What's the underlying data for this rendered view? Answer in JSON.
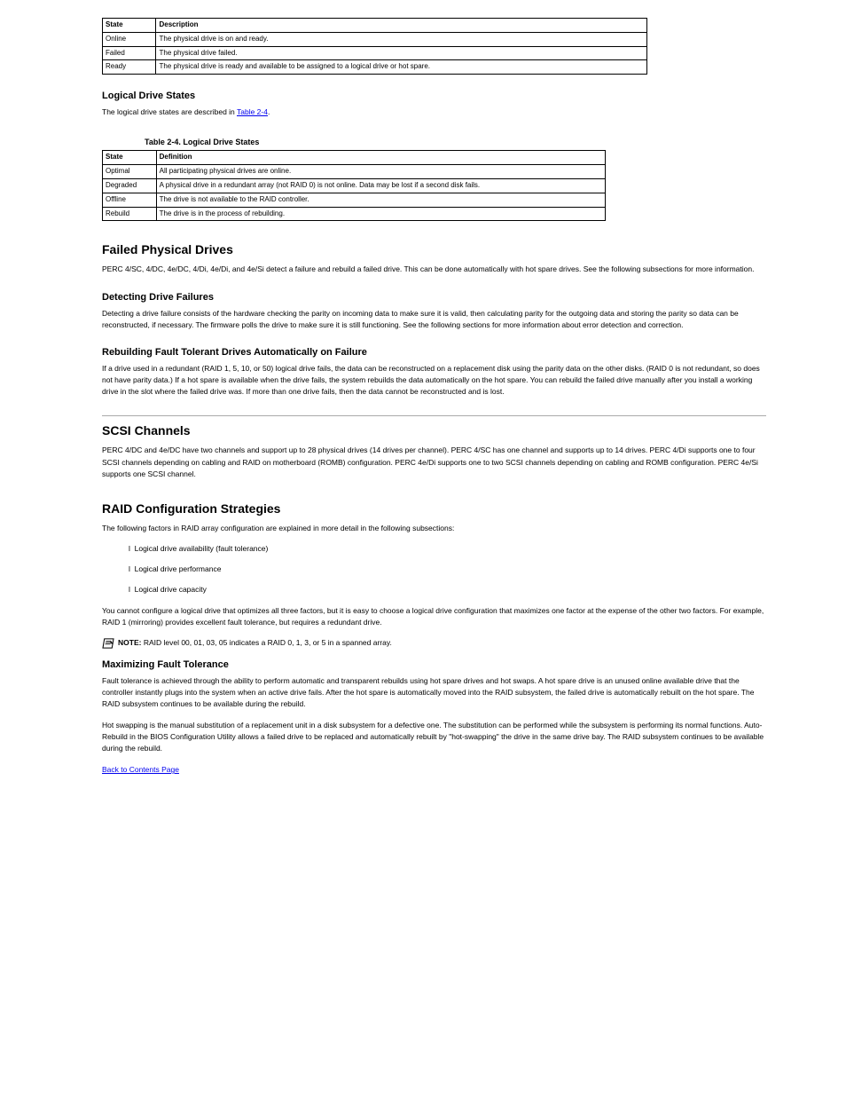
{
  "table3": {
    "hdr": {
      "c0": "State",
      "c1": "Description"
    },
    "rows": [
      {
        "c0": "Online",
        "c1": "The physical drive is on and ready."
      },
      {
        "c0": "Failed",
        "c1": "The physical drive failed."
      },
      {
        "c0": "Ready",
        "c1": "The physical drive is ready and available to be assigned to a logical drive or hot spare."
      }
    ]
  },
  "logical_drive_states": {
    "heading": "Logical Drive States",
    "intro_parts": {
      "a": "The logical drive states are described in ",
      "link": "Table 2-4",
      "b": "."
    }
  },
  "caption4": "Table 2-4. Logical Drive States",
  "table4": {
    "hdr": {
      "c0": "State",
      "c1": "Definition"
    },
    "rows": [
      {
        "c0": "Optimal",
        "c1": "All participating physical drives are online."
      },
      {
        "c0": "Degraded",
        "c1": "A physical drive in a redundant array (not RAID 0) is not online. Data may be lost if a second disk fails."
      },
      {
        "c0": "Offline",
        "c1": "The drive is not available to the RAID controller."
      },
      {
        "c0": "Rebuild",
        "c1": "The drive is in the process of rebuilding."
      }
    ]
  },
  "failed": {
    "heading": "Failed Physical Drives",
    "intro": "PERC 4/SC, 4/DC, 4e/DC, 4/Di, 4e/Di, and 4e/Si detect a failure and rebuild a failed drive. This can be done automatically with hot spare drives. See the following subsections for more information."
  },
  "detect": {
    "heading": "Detecting Drive Failures",
    "body": "Detecting a drive failure consists of the hardware checking the parity on incoming data to make sure it is valid, then calculating parity for the outgoing data and storing the parity so data can be reconstructed, if necessary. The firmware polls the drive to make sure it is still functioning. See the following sections for more information about error detection and correction."
  },
  "auto": {
    "heading": "Rebuilding Fault Tolerant Drives Automatically on Failure",
    "body": "If a drive used in a redundant (RAID 1, 5, 10, or 50) logical drive fails, the data can be reconstructed on a replacement disk using the parity data on the other disks. (RAID 0 is not redundant, so does not have parity data.) If a hot spare is available when the drive fails, the system rebuilds the data automatically on the hot spare. You can rebuild the failed drive manually after you install a working drive in the slot where the failed drive was. If more than one drive fails, then the data cannot be reconstructed and is lost."
  },
  "channels": {
    "heading": "SCSI Channels",
    "body": "PERC 4/DC and 4e/DC have two channels and support up to 28 physical drives (14 drives per channel). PERC 4/SC has one channel and supports up to 14 drives. PERC 4/Di supports one to four SCSI channels depending on cabling and RAID on motherboard (ROMB) configuration. PERC 4e/Di supports one to two SCSI channels depending on cabling and ROMB configuration. PERC 4e/Si supports one SCSI channel."
  },
  "strategies": {
    "heading": "RAID Configuration Strategies",
    "p1": "The following factors in RAID array configuration are explained in more detail in the following subsections:",
    "b1": "Logical drive availability (fault tolerance)",
    "b2": "Logical drive performance",
    "b3": "Logical drive capacity",
    "p2": "You cannot configure a logical drive that optimizes all three factors, but it is easy to choose a logical drive configuration that maximizes one factor at the expense of the other two factors. For example, RAID 1 (mirroring) provides excellent fault tolerance, but requires a redundant drive.",
    "note": {
      "label": "NOTE: ",
      "text": "RAID level 00, 01, 03, 05 indicates a RAID 0, 1, 3, or 5 in a spanned array."
    }
  },
  "maxft": {
    "heading": "Maximizing Fault Tolerance",
    "body": "Fault tolerance is achieved through the ability to perform automatic and transparent rebuilds using hot spare drives and hot swaps. A hot spare drive is an unused online available drive that the controller instantly plugs into the system when an active drive fails. After the hot spare is automatically moved into the RAID subsystem, the failed drive is automatically rebuilt on the hot spare. The RAID subsystem continues to be available during the rebuild.",
    "hotswap": "Hot swapping is the manual substitution of a replacement unit in a disk subsystem for a defective one. The substitution can be performed while the subsystem is performing its normal functions. Auto-Rebuild in the BIOS Configuration Utility allows a failed drive to be replaced and automatically rebuilt by \"hot-swapping\" the drive in the same drive bay. The RAID subsystem continues to be available during the rebuild."
  },
  "nav": "Back to Contents Page"
}
